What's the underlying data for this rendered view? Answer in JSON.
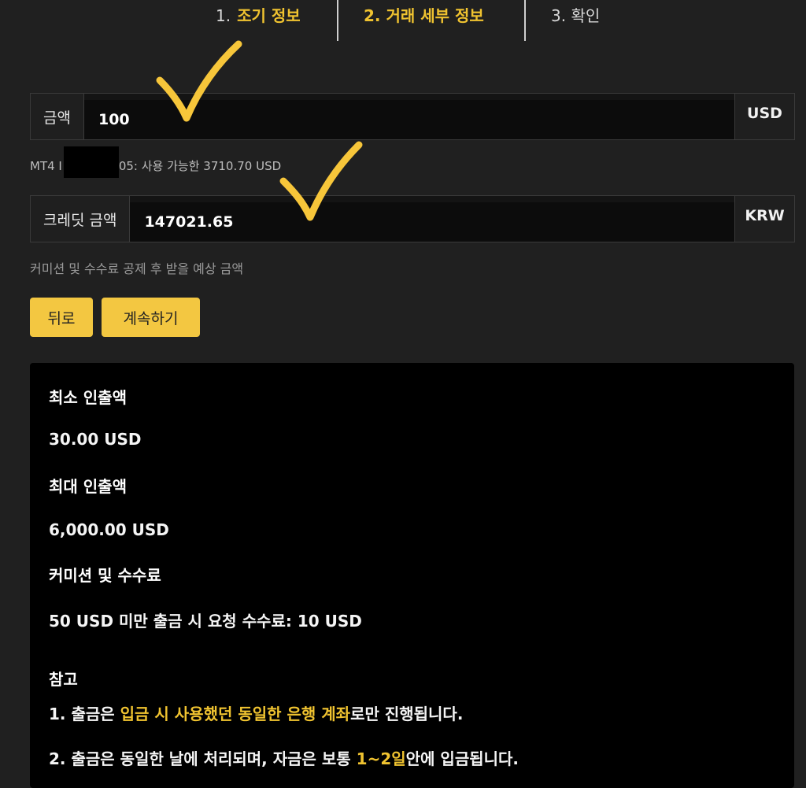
{
  "steps": [
    {
      "number": "1.",
      "label": "조기 정보"
    },
    {
      "label": "2. 거래 세부 정보"
    },
    {
      "label": "3. 확인"
    }
  ],
  "amount": {
    "label": "금액",
    "value": "100",
    "unit": "USD"
  },
  "account_line": {
    "prefix": "MT4 I",
    "suffix": "05: 사용 가능한 3710.70 USD"
  },
  "credit": {
    "label": "크레딧 금액",
    "value": "147021.65",
    "unit": "KRW"
  },
  "hint": "커미션 및 수수료 공제 후 받을 예상 금액",
  "buttons": {
    "back": "뒤로",
    "continue": "계속하기"
  },
  "info": {
    "min_title": "최소 인출액",
    "min_value": "30.00 USD",
    "max_title": "최대 인출액",
    "max_value": "6,000.00 USD",
    "fee_title": "커미션 및 수수료",
    "fee_value": "50 USD 미만 출금 시 요청 수수료: 10 USD",
    "note_title": "참고",
    "note1": {
      "a": "1. 출금은 ",
      "b": "입금 시 사용했던 동일한 은행 계좌",
      "c": "로만 진행됩니다."
    },
    "note2": {
      "a": "2. 출금은 동일한 날에 처리되며, 자금은 보통 ",
      "b": "1~2일",
      "c": "안에 입금됩니다."
    }
  },
  "colors": {
    "accent": "#f3c741",
    "checkmark": "#f7c63a",
    "background": "#202020",
    "panel": "#000000"
  }
}
